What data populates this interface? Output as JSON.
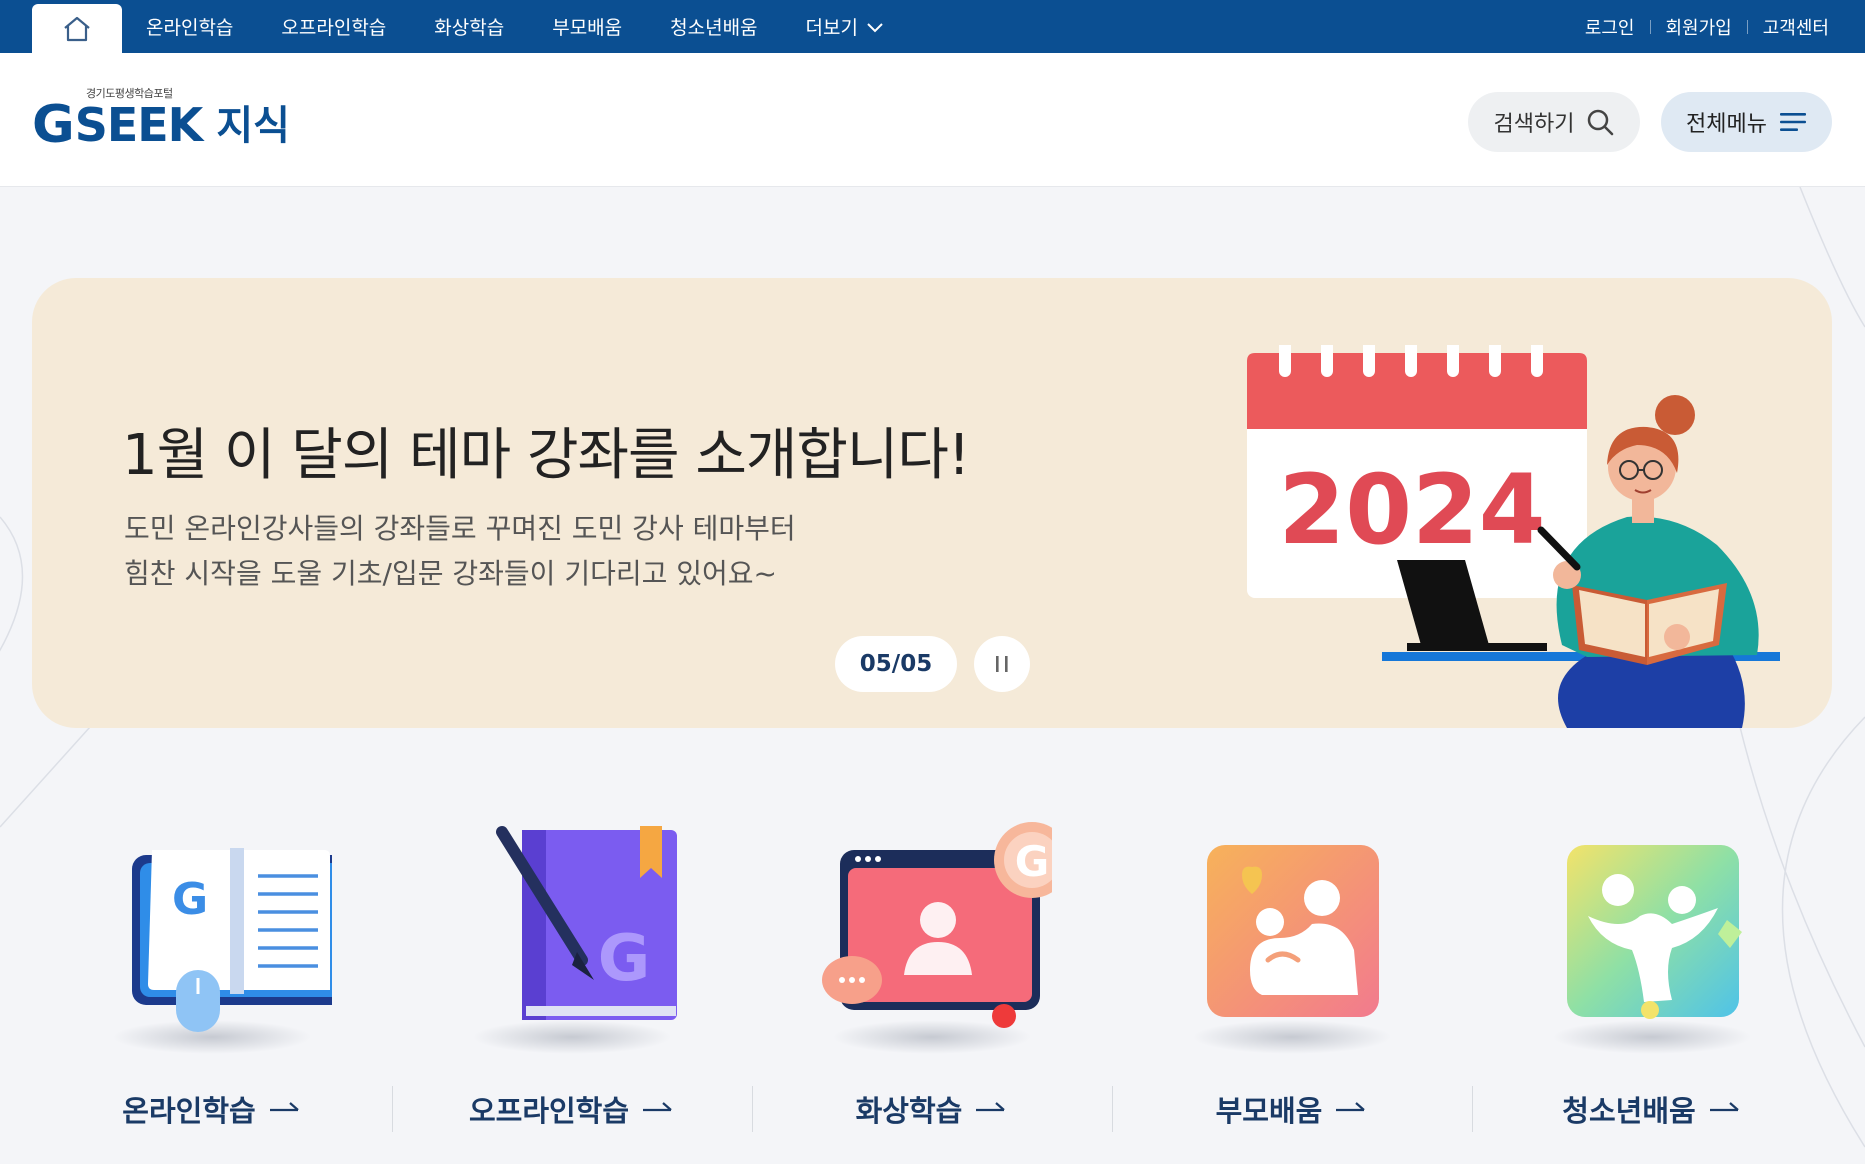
{
  "topbar": {
    "nav": [
      {
        "label": "온라인학습"
      },
      {
        "label": "오프라인학습"
      },
      {
        "label": "화상학습"
      },
      {
        "label": "부모배움"
      },
      {
        "label": "청소년배움"
      },
      {
        "label": "더보기"
      }
    ],
    "util": {
      "login": "로그인",
      "signup": "회원가입",
      "support": "고객센터"
    }
  },
  "header": {
    "logo_small": "경기도평생학습포털",
    "logo_g": "G",
    "logo_seek": "SEEK",
    "logo_jisik": "지식",
    "search_label": "검색하기",
    "menu_label": "전체메뉴"
  },
  "banner": {
    "title": "1월 이 달의 테마 강좌를 소개합니다!",
    "desc_line1": "도민 온라인강사들의 강좌들로 꾸며진 도민 강사 테마부터",
    "desc_line2": "힘찬 시작을 도울 기초/입문 강좌들이 기다리고 있어요~",
    "counter": "05/05",
    "calendar_year": "2024"
  },
  "quick_links": [
    {
      "label": "온라인학습",
      "icon": "online-learning-icon"
    },
    {
      "label": "오프라인학습",
      "icon": "offline-learning-icon"
    },
    {
      "label": "화상학습",
      "icon": "video-learning-icon"
    },
    {
      "label": "부모배움",
      "icon": "parent-learning-icon"
    },
    {
      "label": "청소년배움",
      "icon": "youth-learning-icon"
    }
  ],
  "colors": {
    "brand": "#0b4f92",
    "banner_bg": "#f5ead8",
    "page_bg": "#f4f5f8"
  }
}
